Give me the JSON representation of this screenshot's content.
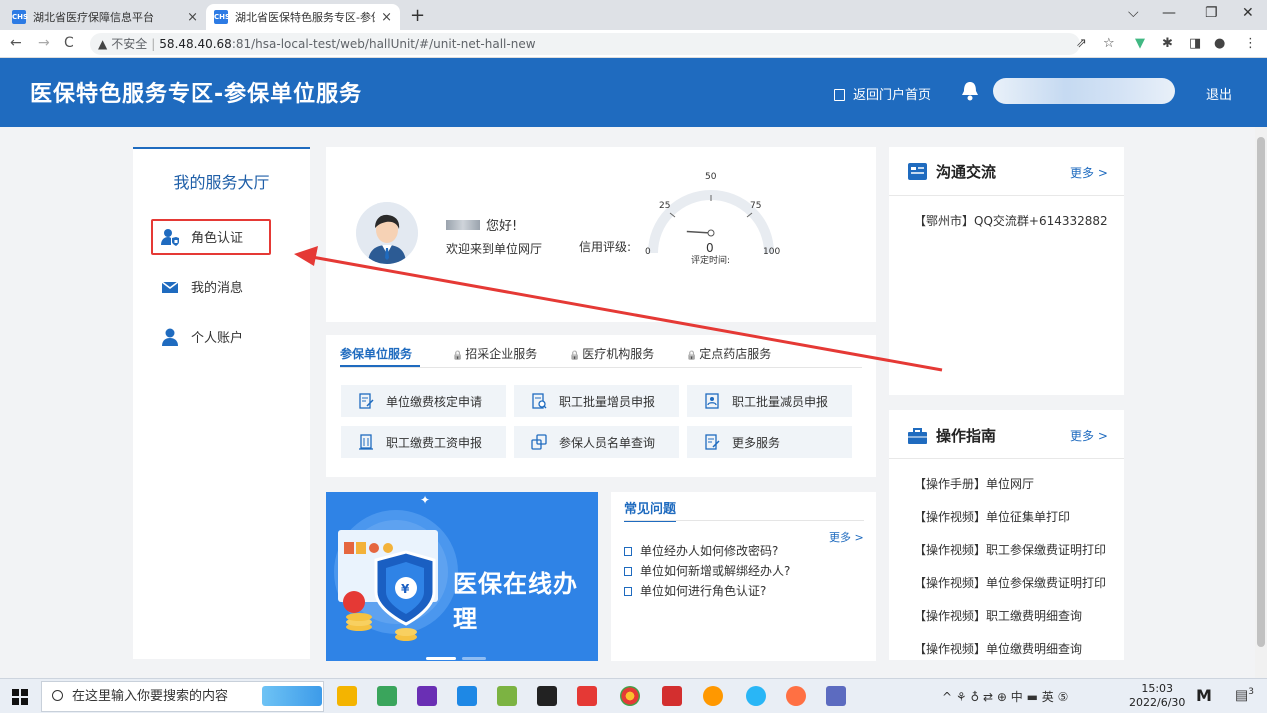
{
  "browser": {
    "tabs": [
      {
        "label": "湖北省医疗保障信息平台",
        "close": "×"
      },
      {
        "label": "湖北省医保特色服务专区-参保单",
        "close": "×"
      }
    ],
    "new_tab": "+",
    "window_controls": [
      "⌵",
      "—",
      "❐",
      "✕"
    ],
    "nav": {
      "back": "←",
      "forward": "→",
      "reload": "C"
    },
    "address": {
      "warning": "▲",
      "insecure": "不安全",
      "host": "58.48.40.68",
      "path": ":81/hsa-local-test/web/hallUnit/#/unit-net-hall-new"
    }
  },
  "header": {
    "title": "医保特色服务专区-参保单位服务",
    "home_link": "返回门户首页",
    "logout": "退出",
    "accent": "#1f6bbf"
  },
  "sidebar": {
    "title": "我的服务大厅",
    "items": [
      {
        "label": "角色认证",
        "icon": "user-shield-icon"
      },
      {
        "label": "我的消息",
        "icon": "envelope-icon"
      },
      {
        "label": "个人账户",
        "icon": "person-icon"
      }
    ]
  },
  "profile": {
    "greeting": "您好!",
    "welcome": "欢迎来到单位网厅",
    "credit_label": "信用评级:",
    "gauge": {
      "ticks": [
        "0",
        "25",
        "50",
        "75",
        "100"
      ],
      "value": 0,
      "value_label": "0",
      "eval_time_label": "评定时间:"
    }
  },
  "services": {
    "tabs": [
      {
        "label": "参保单位服务",
        "active": true,
        "locked": false
      },
      {
        "label": "招采企业服务",
        "active": false,
        "locked": true
      },
      {
        "label": "医疗机构服务",
        "active": false,
        "locked": true
      },
      {
        "label": "定点药店服务",
        "active": false,
        "locked": true
      }
    ],
    "lock_glyph": "🔒",
    "buttons": [
      {
        "label": "单位缴费核定申请"
      },
      {
        "label": "职工批量增员申报"
      },
      {
        "label": "职工批量减员申报"
      },
      {
        "label": "职工缴费工资申报"
      },
      {
        "label": "参保人员名单查询"
      },
      {
        "label": "更多服务"
      }
    ]
  },
  "banner": {
    "text": "医保在线办理"
  },
  "faq": {
    "title": "常见问题",
    "more": "更多 >",
    "items": [
      "单位经办人如何修改密码?",
      "单位如何新增或解绑经办人?",
      "单位如何进行角色认证?"
    ]
  },
  "communication": {
    "title": "沟通交流",
    "more": "更多 >",
    "items": [
      "【鄂州市】QQ交流群+614332882"
    ]
  },
  "guide": {
    "title": "操作指南",
    "more": "更多 >",
    "items": [
      "【操作手册】单位网厅",
      "【操作视频】单位征集单打印",
      "【操作视频】职工参保缴费证明打印",
      "【操作视频】单位参保缴费证明打印",
      "【操作视频】职工缴费明细查询",
      "【操作视频】单位缴费明细查询"
    ]
  },
  "taskbar": {
    "search_placeholder": "在这里输入你要搜索的内容",
    "tray": "^ ⚘ ♁ ⇄ ⊕ 中 ▬ 英 ⑤",
    "time": "15:03",
    "date": "2022/6/30",
    "ime": "M",
    "notification_count": "3"
  }
}
